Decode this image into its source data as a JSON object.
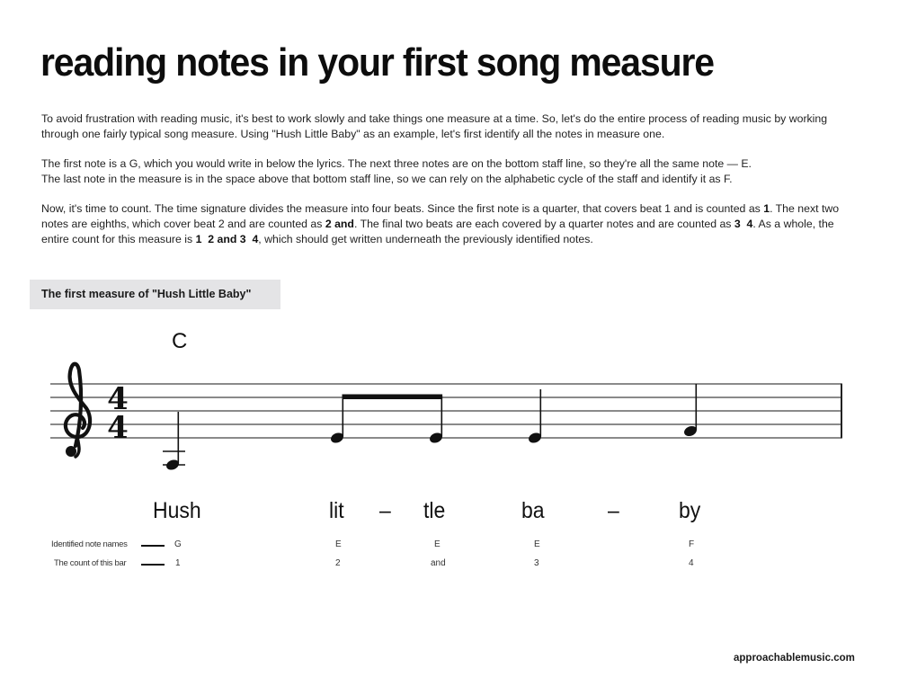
{
  "header": {
    "title": "reading notes in your first song measure"
  },
  "paragraphs": {
    "p1": "To avoid frustration with reading music, it's best to work slowly and take things one measure at a time. So, let's do the entire process of reading music by working through one fairly typical song measure. Using \"Hush Little Baby\" as an example, let's first identify all the notes in measure one.",
    "p2_line1": "The first note is a G, which you would write in below the lyrics. The next three notes are on the bottom staff line, so they're all the same note — E.",
    "p2_line2": "The last note in the measure is in the space above that bottom staff line, so we can rely on the alphabetic cycle of the staff and identify it as F.",
    "p3": {
      "s1": "Now, it's time to count. The time signature divides the measure into four beats. Since the first note is a quarter, that covers beat 1 and is counted as ",
      "b1": "1",
      "s2": ". The next two notes are eighths, which cover beat 2 and are counted as ",
      "b2": "2 and",
      "s3": ". The final two beats are each covered by a quarter notes and are counted as ",
      "b3": "3  4",
      "s4": ". As a whole, the entire count for this measure is ",
      "b4": "1  2 and 3  4",
      "s5": ", which should get written underneath the previously identified notes."
    }
  },
  "figure": {
    "caption": "The first measure of \"Hush Little Baby\"",
    "chord": "C",
    "clef": "treble",
    "time_signature": {
      "top": "4",
      "bottom": "4"
    },
    "notes": [
      {
        "pitch": "G",
        "duration": "quarter",
        "staff_step": -4
      },
      {
        "pitch": "E",
        "duration": "eighth",
        "staff_step": 0
      },
      {
        "pitch": "E",
        "duration": "eighth",
        "staff_step": 0
      },
      {
        "pitch": "E",
        "duration": "quarter",
        "staff_step": 0
      },
      {
        "pitch": "F",
        "duration": "quarter",
        "staff_step": 1
      }
    ],
    "lyrics": [
      "Hush",
      "lit",
      "–",
      "tle",
      "ba",
      "–",
      "by"
    ],
    "rows": {
      "names_label": "Identified note names",
      "names": [
        "G",
        "E",
        "E",
        "E",
        "F"
      ],
      "count_label": "The count of this bar",
      "count": [
        "1",
        "2",
        "and",
        "3",
        "4"
      ]
    }
  },
  "footer": {
    "site": "approachablemusic.com"
  }
}
